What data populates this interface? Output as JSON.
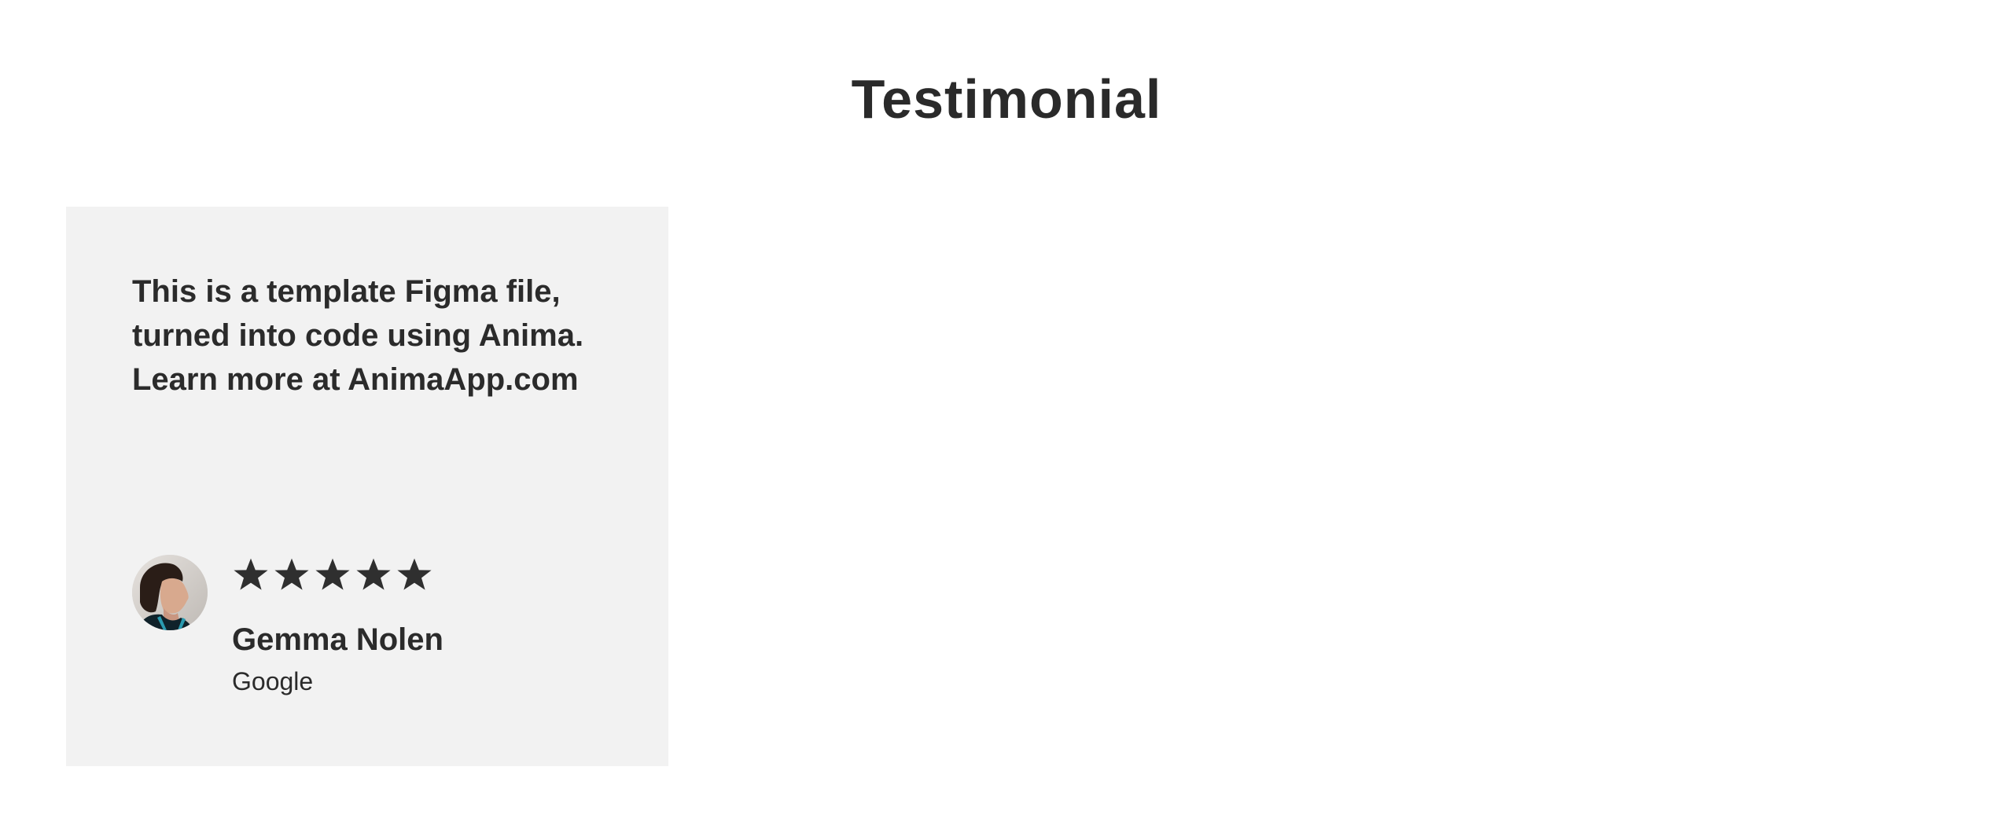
{
  "section": {
    "title": "Testimonial"
  },
  "testimonial": {
    "quote": "This is a template Figma file, turned into code using Anima. Learn more at AnimaApp.com",
    "rating": 5,
    "rating_max": 5,
    "author": {
      "name": "Gemma Nolen",
      "company": "Google",
      "avatar_icon": "person-photo"
    },
    "star_icon": "star-icon"
  },
  "colors": {
    "text": "#2b2b2b",
    "card_background": "#f2f2f2",
    "page_background": "#ffffff"
  }
}
